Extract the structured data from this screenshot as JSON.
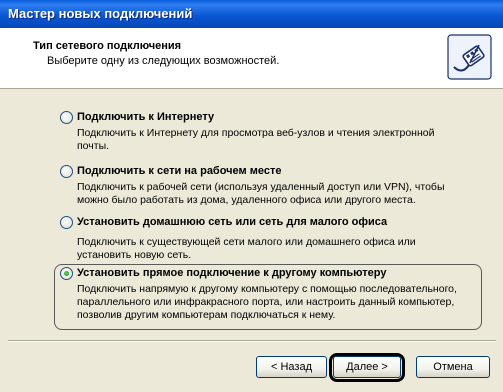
{
  "window": {
    "title": "Мастер новых подключений"
  },
  "header": {
    "title": "Тип сетевого подключения",
    "subtitle": "Выберите одну из следующих возможностей.",
    "icon": "network-cable-icon"
  },
  "options": [
    {
      "label": "Подключить к Интернету",
      "desc_lines": [
        "Подключить к Интернету для просмотра веб-узлов и чтения электронной",
        "почты."
      ],
      "selected": false
    },
    {
      "label": "Подключить к сети на рабочем месте",
      "desc_lines": [
        "Подключить к рабочей сети (используя удаленный доступ или VPN), чтобы",
        "можно было работать из дома, удаленного офиса или другого места."
      ],
      "selected": false
    },
    {
      "label": "Установить домашнюю сеть или сеть для малого офиса",
      "desc_lines": [
        "Подключить к существующей сети малого или домашнего офиса или",
        "установить новую сеть."
      ],
      "selected": false
    },
    {
      "label": "Установить прямое подключение к другому компьютеру",
      "desc_lines": [
        "Подключить напрямую к другому компьютеру с помощью последовательного,",
        "параллельного или инфракрасного порта, или настроить данный компьютер,",
        "позволив другим компьютерам подключаться к нему."
      ],
      "selected": true
    }
  ],
  "buttons": {
    "back": "< Назад",
    "next": "Далее >",
    "cancel": "Отмена"
  }
}
